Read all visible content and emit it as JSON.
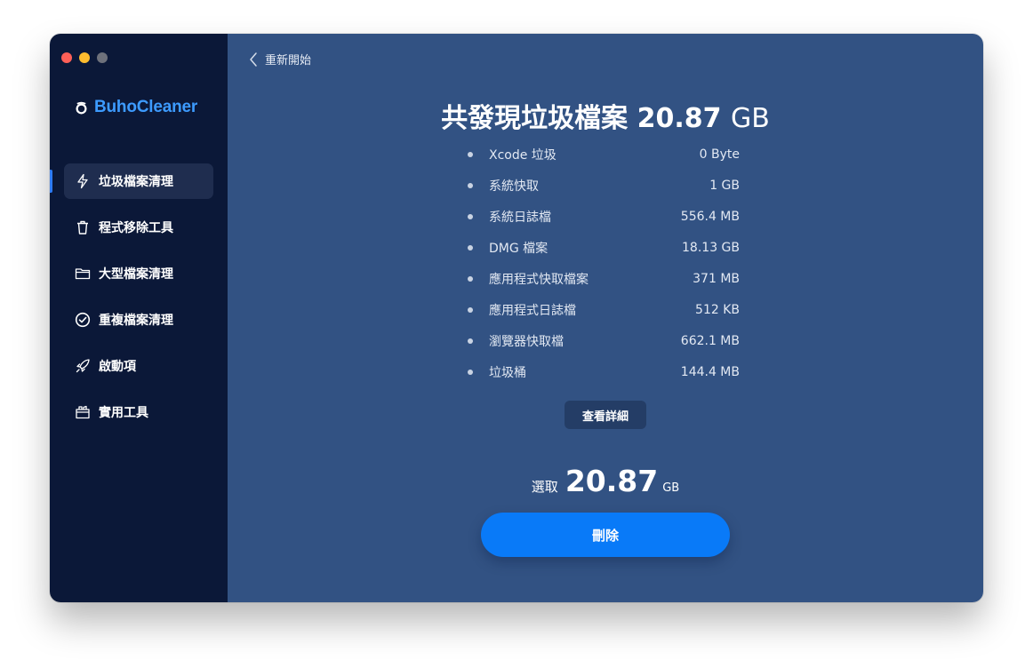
{
  "app": {
    "name": "BuhoCleaner",
    "accent_color": "#3d9bff"
  },
  "sidebar": {
    "items": [
      {
        "label": "垃圾檔案清理",
        "icon": "lightning-icon",
        "active": true
      },
      {
        "label": "程式移除工具",
        "icon": "trash-icon",
        "active": false
      },
      {
        "label": "大型檔案清理",
        "icon": "folder-icon",
        "active": false
      },
      {
        "label": "重複檔案清理",
        "icon": "check-circle-icon",
        "active": false
      },
      {
        "label": "啟動項",
        "icon": "rocket-icon",
        "active": false
      },
      {
        "label": "實用工具",
        "icon": "toolbox-icon",
        "active": false
      }
    ]
  },
  "main": {
    "back_label": "重新開始",
    "headline_prefix": "共發現垃圾檔案",
    "headline_value": "20.87",
    "headline_unit": "GB",
    "results": [
      {
        "name": "Xcode 垃圾",
        "size": "0 Byte"
      },
      {
        "name": "系統快取",
        "size": "1 GB"
      },
      {
        "name": "系統日誌檔",
        "size": "556.4 MB"
      },
      {
        "name": "DMG 檔案",
        "size": "18.13 GB"
      },
      {
        "name": "應用程式快取檔案",
        "size": "371 MB"
      },
      {
        "name": "應用程式日誌檔",
        "size": "512 KB"
      },
      {
        "name": "瀏覽器快取檔",
        "size": "662.1 MB"
      },
      {
        "name": "垃圾桶",
        "size": "144.4 MB"
      }
    ],
    "details_label": "查看詳細",
    "selected_label": "選取",
    "selected_value": "20.87",
    "selected_unit": "GB",
    "delete_label": "刪除",
    "background_color": "#325283",
    "button_color": "#097af8"
  }
}
